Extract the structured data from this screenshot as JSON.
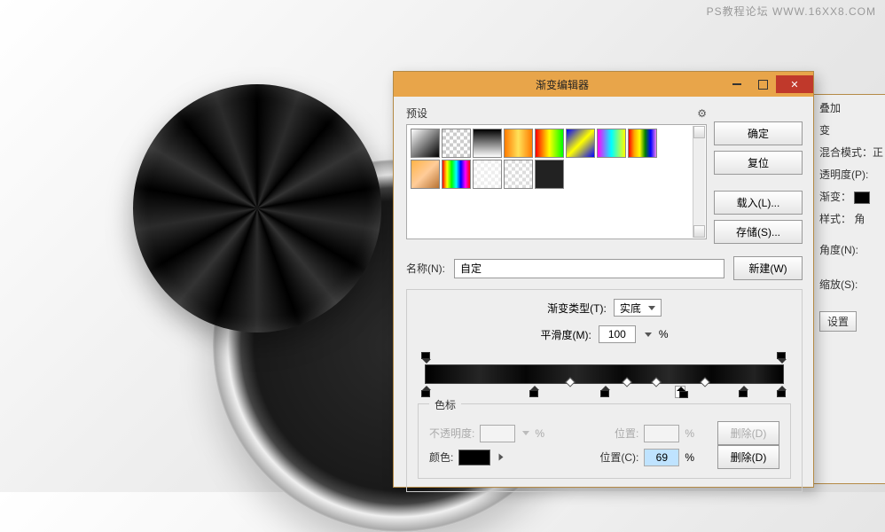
{
  "watermark": "PS教程论坛 WWW.16XX8.COM",
  "dialog": {
    "title": "渐变编辑器",
    "presets_label": "预设",
    "gear_icon": "⚙",
    "buttons": {
      "ok": "确定",
      "cancel": "复位",
      "load": "载入(L)...",
      "save": "存储(S)..."
    },
    "name_label": "名称(N):",
    "name_value": "自定",
    "new_btn": "新建(W)",
    "grad_type_label": "渐变类型(T):",
    "grad_type_value": "实底",
    "smoothness_label": "平滑度(M):",
    "smoothness_value": "100",
    "percent": "%",
    "stops_title": "色标",
    "opacity_label": "不透明度:",
    "opacity_value": "",
    "position_label": "位置:",
    "position_value": "",
    "delete_btn": "删除(D)",
    "color_label": "颜色:",
    "color_value": "#000000",
    "color_position_label": "位置(C):",
    "color_position_value": "69"
  },
  "side": {
    "overlay": "叠加",
    "grad": "变",
    "blend_label": "混合模式：",
    "blend_value": "正",
    "opacity_label": "透明度(P):",
    "grad_label": "渐变：",
    "style_label": "样式：",
    "style_value": "角",
    "angle_label": "角度(N):",
    "scale_label": "缩放(S):",
    "settings_btn": "设置"
  }
}
